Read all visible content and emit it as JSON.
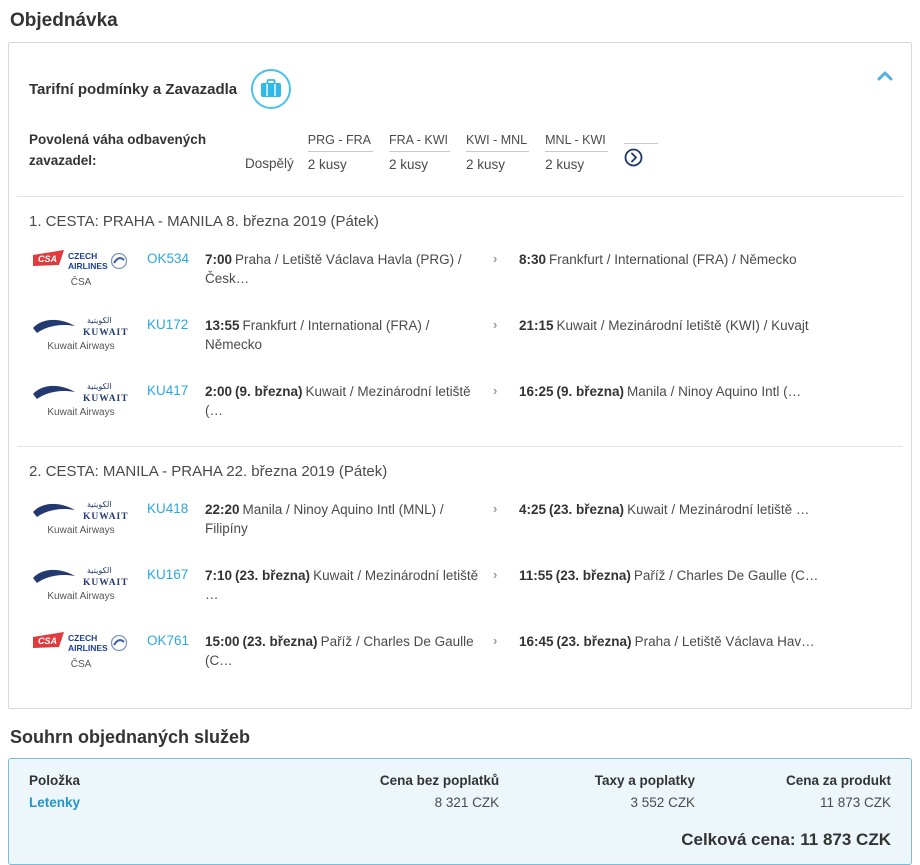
{
  "page": {
    "title": "Objednávka"
  },
  "colors": {
    "accent_light_blue": "#49c2ea",
    "link_blue": "#2da7e0",
    "summary_border": "#79bcdb",
    "summary_bg": "#ecf6fb",
    "csa_red": "#e03a3e",
    "airline_navy": "#223a70"
  },
  "tariff": {
    "title": "Tarifní podmínky a Zavazadla",
    "label_line1": "Povolená váha odbavených",
    "label_line2": "zavazadel:",
    "passenger": "Dospělý",
    "columns": [
      {
        "route": "PRG - FRA",
        "qty": "2 kusy"
      },
      {
        "route": "FRA - KWI",
        "qty": "2 kusy"
      },
      {
        "route": "KWI - MNL",
        "qty": "2 kusy"
      },
      {
        "route": "MNL - KWI",
        "qty": "2 kusy"
      }
    ]
  },
  "logos": {
    "csa": {
      "mark": "CSA",
      "line1": "CZECH",
      "line2": "AIRLINES",
      "caption": "ČSA"
    },
    "kuwait": {
      "arabic": "الكويتية",
      "name": "KUWAIT",
      "caption": "Kuwait Airways"
    }
  },
  "trips": [
    {
      "header": "1. CESTA: PRAHA - MANILA 8. března 2019 (Pátek)",
      "flights": [
        {
          "flight_no": "OK534",
          "dep": {
            "time": "7:00",
            "date": "",
            "place": "Praha / Letiště Václava Havla (PRG) / Česk…"
          },
          "arr": {
            "time": "8:30",
            "date": "",
            "place": "Frankfurt / International (FRA) / Německo"
          }
        },
        {
          "flight_no": "KU172",
          "dep": {
            "time": "13:55",
            "date": "",
            "place": "Frankfurt / International (FRA) / Německo"
          },
          "arr": {
            "time": "21:15",
            "date": "",
            "place": "Kuwait / Mezinárodní letiště (KWI) / Kuvajt"
          }
        },
        {
          "flight_no": "KU417",
          "dep": {
            "time": "2:00",
            "date": "(9. března)",
            "place": "Kuwait / Mezinárodní letiště (…"
          },
          "arr": {
            "time": "16:25",
            "date": "(9. března)",
            "place": "Manila / Ninoy Aquino Intl (…"
          }
        }
      ]
    },
    {
      "header": "2. CESTA: MANILA - PRAHA 22. března 2019 (Pátek)",
      "flights": [
        {
          "flight_no": "KU418",
          "dep": {
            "time": "22:20",
            "date": "",
            "place": "Manila / Ninoy Aquino Intl (MNL) / Filipíny"
          },
          "arr": {
            "time": "4:25",
            "date": "(23. března)",
            "place": "Kuwait / Mezinárodní letiště …"
          }
        },
        {
          "flight_no": "KU167",
          "dep": {
            "time": "7:10",
            "date": "(23. března)",
            "place": "Kuwait / Mezinárodní letiště …"
          },
          "arr": {
            "time": "11:55",
            "date": "(23. března)",
            "place": "Paříž / Charles De Gaulle (C…"
          }
        },
        {
          "flight_no": "OK761",
          "dep": {
            "time": "15:00",
            "date": "(23. března)",
            "place": "Paříž / Charles De Gaulle (C…"
          },
          "arr": {
            "time": "16:45",
            "date": "(23. března)",
            "place": "Praha / Letiště Václava Hav…"
          }
        }
      ]
    }
  ],
  "summary": {
    "title": "Souhrn objednaných služeb",
    "columns": [
      "Položka",
      "Cena bez poplatků",
      "Taxy a poplatky",
      "Cena za produkt"
    ],
    "row": {
      "item": "Letenky",
      "price_no_fees": "8 321 CZK",
      "taxes": "3 552 CZK",
      "product_price": "11 873 CZK"
    },
    "total": "Celková cena: 11 873 CZK"
  }
}
